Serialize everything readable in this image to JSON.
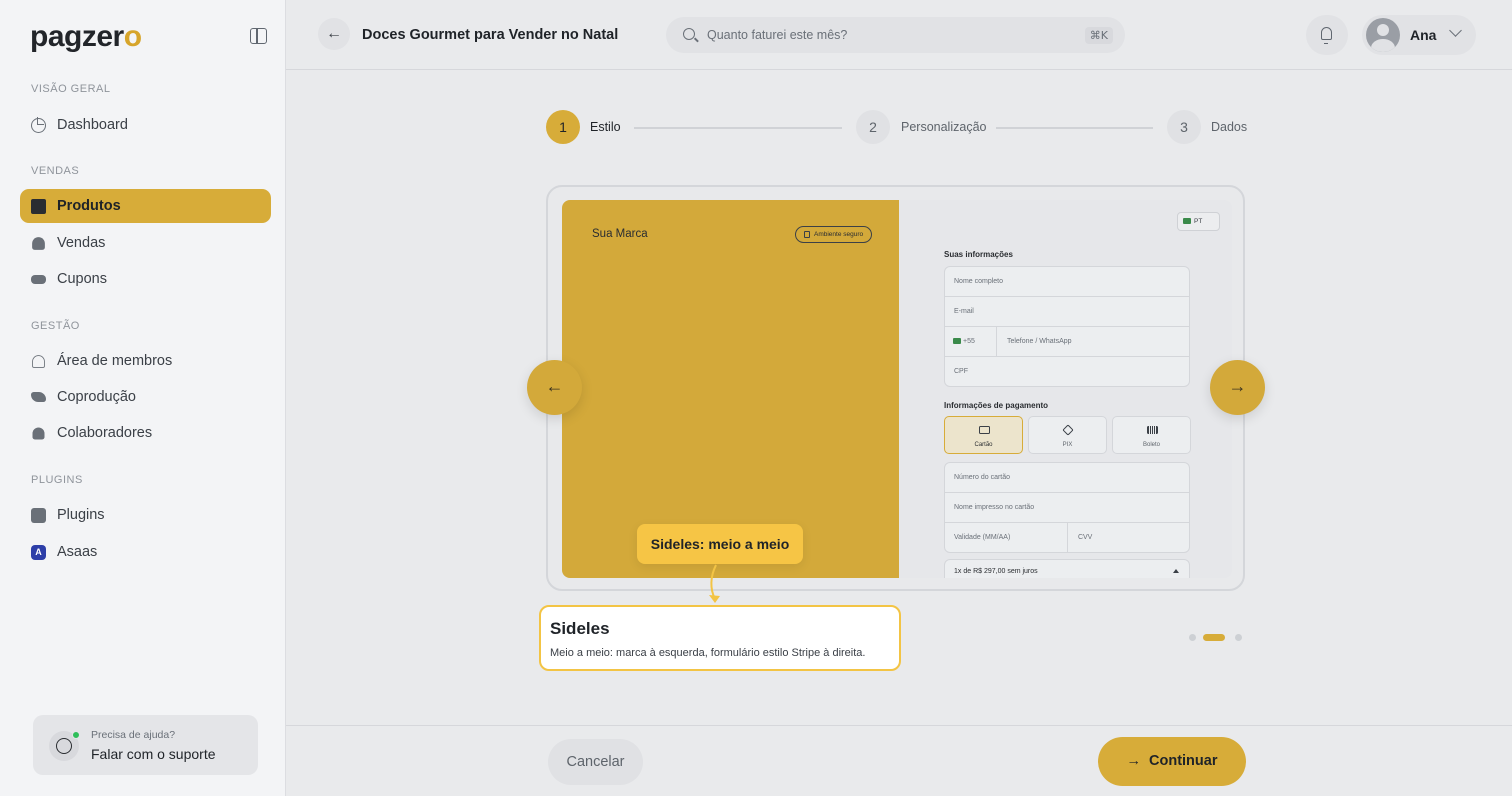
{
  "sidebar": {
    "logo": "pagzer",
    "logo_accent": "o",
    "sections": [
      {
        "title": "VISÃO GERAL"
      },
      {
        "title": "VENDAS"
      },
      {
        "title": "GESTÃO"
      },
      {
        "title": "PLUGINS"
      }
    ],
    "items": [
      {
        "label": "Dashboard",
        "icon": "dashboard-icon"
      },
      {
        "label": "Produtos",
        "icon": "box-icon",
        "active": true
      },
      {
        "label": "Vendas",
        "icon": "sales-icon"
      },
      {
        "label": "Cupons",
        "icon": "ticket-icon"
      },
      {
        "label": "Área de membros",
        "icon": "users-icon"
      },
      {
        "label": "Coprodução",
        "icon": "handshake-icon"
      },
      {
        "label": "Colaboradores",
        "icon": "person-icon"
      },
      {
        "label": "Plugins",
        "icon": "puzzle-icon"
      },
      {
        "label": "Asaas",
        "icon": "asaas-icon",
        "icon_letter": "A"
      }
    ],
    "help": {
      "sub": "Precisa de ajuda?",
      "main": "Falar com o suporte"
    }
  },
  "header": {
    "title": "Doces Gourmet para Vender no Natal",
    "search_placeholder": "Quanto faturei este mês?",
    "shortcut": "⌘K",
    "user_name": "Ana"
  },
  "stepper": [
    {
      "number": "1",
      "label": "Estilo",
      "active": true
    },
    {
      "number": "2",
      "label": "Personalização",
      "active": false
    },
    {
      "number": "3",
      "label": "Dados",
      "active": false
    }
  ],
  "preview": {
    "brand_name": "Sua Marca",
    "secure_badge": "Ambiente seguro",
    "lang": "PT",
    "your_info_title": "Suas informações",
    "full_name": "Nome completo",
    "email": "E-mail",
    "phone_code": "+55",
    "phone": "Telefone / WhatsApp",
    "cpf": "CPF",
    "payment_title": "Informações de pagamento",
    "payment_options": [
      "Cartão",
      "PIX",
      "Boleto"
    ],
    "card_number": "Número do cartão",
    "card_name": "Nome impresso no cartão",
    "expiry": "Validade (MM/AA)",
    "cvv": "CVV",
    "installments": "1x de R$ 297,00 sem juros"
  },
  "tooltip": {
    "label": "Sideles: meio a meio"
  },
  "style_card": {
    "title": "Sideles",
    "description": "Meio a meio: marca à esquerda, formulário estilo Stripe à direita."
  },
  "carousel": {
    "current": 2,
    "total": 3
  },
  "footer": {
    "cancel": "Cancelar",
    "continue": "Continuar"
  },
  "colors": {
    "accent": "#d7ac39",
    "tooltip": "#f6c545",
    "asaas": "#2d3ea8"
  }
}
